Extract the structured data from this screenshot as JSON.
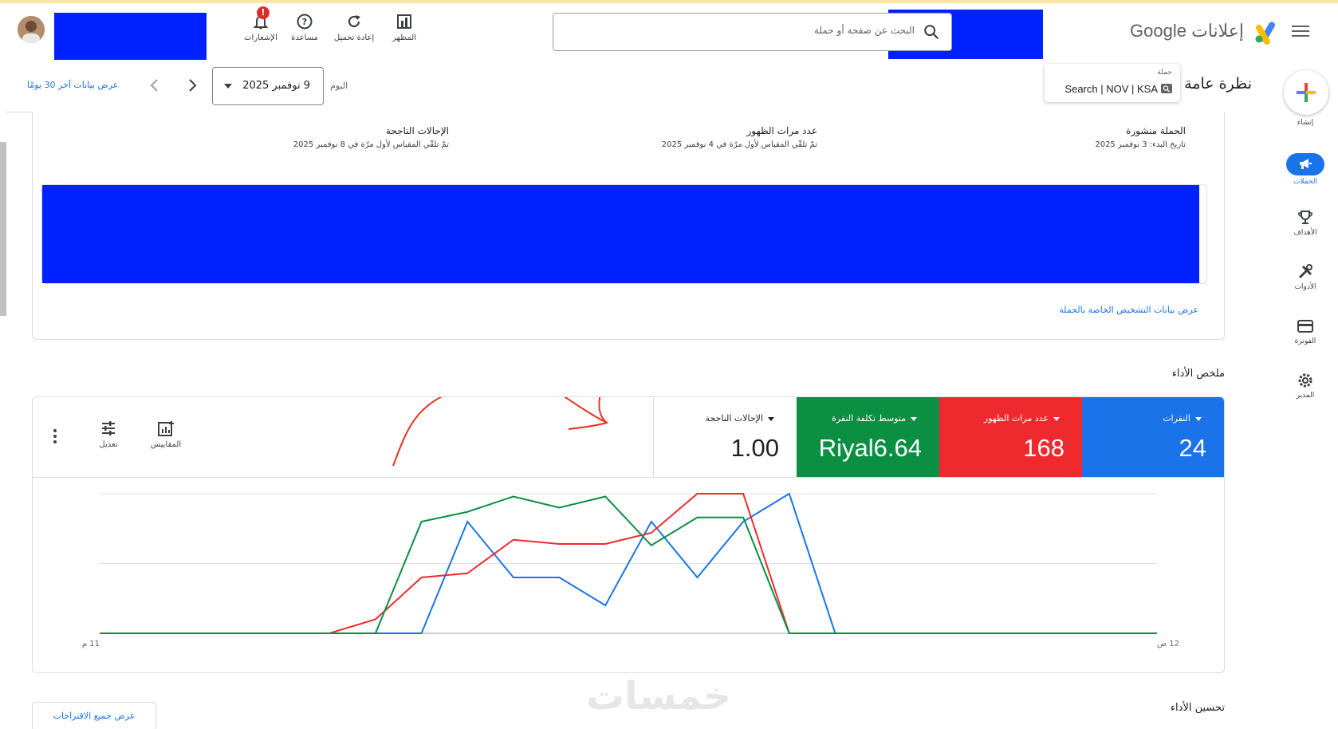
{
  "header": {
    "brand_name": "إعلانات Google",
    "search_placeholder": "البحث عن صفحة أو حملة",
    "tools": [
      {
        "label": "المظهر",
        "icon": "appearance-icon"
      },
      {
        "label": "إعادة تحميل",
        "icon": "refresh-icon"
      },
      {
        "label": "مساعدة",
        "icon": "help-icon"
      },
      {
        "label": "الإشعارات",
        "icon": "bell-icon",
        "badge": "!"
      }
    ],
    "redaction_color": "#0021ff"
  },
  "rail": {
    "create_label": "إنشاء",
    "items": [
      {
        "label": "الحملات",
        "icon": "campaigns-icon",
        "active": true
      },
      {
        "label": "الأهداف",
        "icon": "trophy-icon"
      },
      {
        "label": "الأدوات",
        "icon": "tools-icon"
      },
      {
        "label": "الفوترة",
        "icon": "billing-icon"
      },
      {
        "label": "المدير",
        "icon": "gear-icon"
      }
    ]
  },
  "overview": {
    "title": "نظرة عامة",
    "campaign_caption": "حملة",
    "campaign_name": "Search | NOV | KSA",
    "date_label": "اليوم",
    "date_value": "9 نوفمبر 2025",
    "last30_link": "عرض بيانات آخر 30 يومًا"
  },
  "campaign_card": {
    "stats": [
      {
        "title": "الحملة منشورة",
        "sub": "تاريخ البدء: 3 نوفمبر 2025"
      },
      {
        "title": "عدد مرات الظهور",
        "sub": "تمّ تلقّي المقياس لأول مرّة في 4 نوفمبر 2025"
      },
      {
        "title": "الإحالات الناجحة",
        "sub": "تمّ تلقّي المقياس لأول مرّة في 8 نوفمبر 2025"
      }
    ],
    "diagnostics_link": "عرض بيانات التشخيص الخاصة بالحملة"
  },
  "performance": {
    "title": "ملخص الأداء",
    "metrics": [
      {
        "label": "النقرات",
        "value": "24",
        "color": "#1a73e8"
      },
      {
        "label": "عدد مرات الظهور",
        "value": "168",
        "color": "#ee2a2f"
      },
      {
        "label": "متوسط تكلفة النقرة",
        "value": "Riyal6.64",
        "color": "#0a8f43"
      },
      {
        "label": "الإحالات الناجحة",
        "value": "1.00",
        "color": "#ffffff"
      }
    ],
    "actions": {
      "metrics_label": "المقاييس",
      "adjust_label": "تعديل"
    }
  },
  "chart_data": {
    "type": "line",
    "x_labels": [
      "12 ص",
      "11 م"
    ],
    "x_count": 24,
    "ylim": [
      0,
      1
    ],
    "grid": true,
    "series": [
      {
        "color": "#1a73e8",
        "values": [
          0,
          0,
          0,
          0,
          0,
          0,
          0,
          0,
          0.8,
          0.4,
          0.4,
          0.2,
          0.8,
          0.4,
          0.8,
          1.0,
          0,
          0,
          0,
          0,
          0,
          0,
          0,
          0
        ]
      },
      {
        "color": "#ee2a2f",
        "values": [
          0,
          0,
          0,
          0,
          0,
          0,
          0.1,
          0.4,
          0.43,
          0.67,
          0.64,
          0.64,
          0.72,
          1.0,
          1.0,
          0,
          0,
          0,
          0,
          0,
          0,
          0,
          0,
          0
        ]
      },
      {
        "color": "#0a8f43",
        "values": [
          0,
          0,
          0,
          0,
          0,
          0,
          0,
          0.8,
          0.87,
          0.98,
          0.9,
          0.98,
          0.63,
          0.83,
          0.83,
          0,
          0,
          0,
          0,
          0,
          0,
          0,
          0,
          0
        ]
      }
    ]
  },
  "improve": {
    "title": "تحسين الأداء",
    "all_suggestions_button": "عرض جميع الاقتراحات"
  },
  "watermark": "خمسات"
}
